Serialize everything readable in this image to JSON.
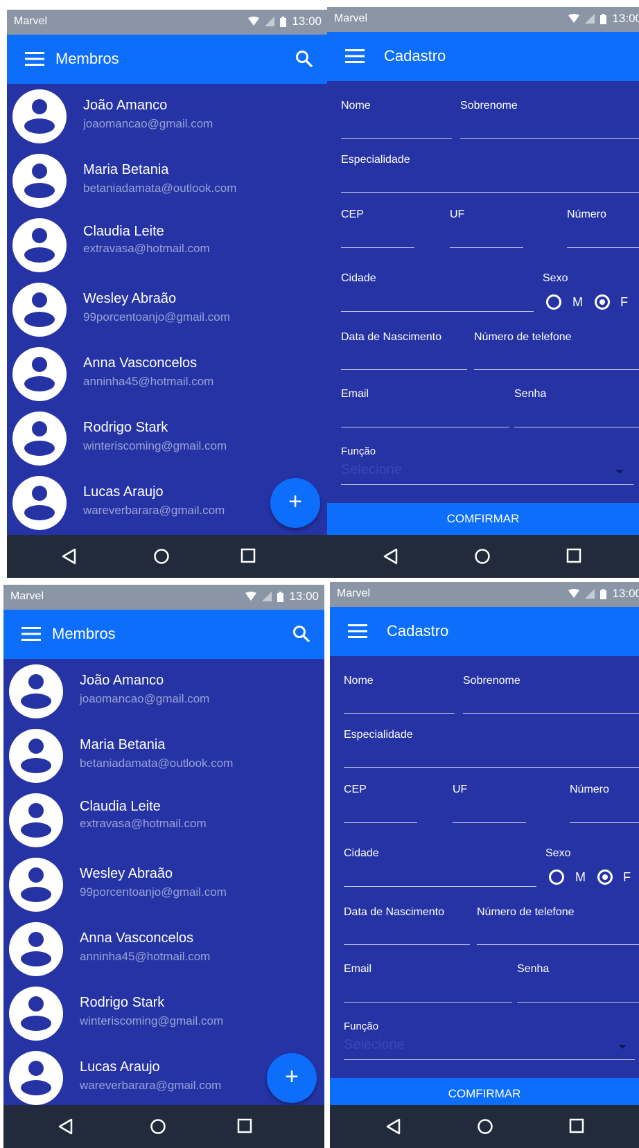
{
  "status": {
    "carrier": "Marvel",
    "time": "13:00"
  },
  "members": {
    "title": "Membros",
    "items": [
      {
        "name": "João Amanco",
        "email": "joaomancao@gmail.com"
      },
      {
        "name": "Maria Betania",
        "email": "betaniadamata@outlook.com"
      },
      {
        "name": "Claudia Leite",
        "email": "extravasa@hotmail.com"
      },
      {
        "name": "Wesley Abraão",
        "email": "99porcentoanjo@gmail.com"
      },
      {
        "name": "Anna Vasconcelos",
        "email": "anninha45@hotmail.com"
      },
      {
        "name": "Rodrigo Stark",
        "email": "winteriscoming@gmail.com"
      },
      {
        "name": "Lucas Araujo",
        "email": "wareverbarara@gmail.com"
      }
    ],
    "fab_label": "+"
  },
  "form": {
    "title": "Cadastro",
    "nome": "Nome",
    "sobrenome": "Sobrenome",
    "especialidade": "Especialidade",
    "cep": "CEP",
    "uf": "UF",
    "numero": "Número",
    "cidade": "Cidade",
    "sexo": "Sexo",
    "sexo_m": "M",
    "sexo_f": "F",
    "sexo_selected": "F",
    "nascimento": "Data de Nascimento",
    "telefone": "Número de telefone",
    "email": "Email",
    "senha": "Senha",
    "funcao": "Função",
    "funcao_placeholder": "Selecione",
    "confirm": "COMFIRMAR"
  },
  "colors": {
    "background": "#2533a5",
    "appbar": "#0d6efc",
    "statusbar": "#8a96a6",
    "navbar": "#212b3b"
  },
  "icons": [
    "menu-icon",
    "search-icon",
    "wifi-icon",
    "signal-icon",
    "battery-icon",
    "avatar-icon",
    "add-icon",
    "back-icon",
    "home-icon",
    "recents-icon",
    "dropdown-caret-icon"
  ]
}
